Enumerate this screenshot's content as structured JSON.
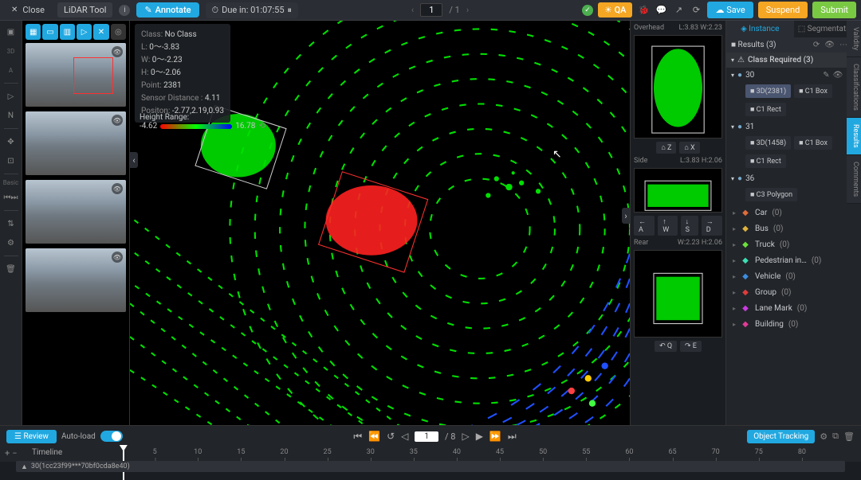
{
  "topbar": {
    "close": "Close",
    "tool": "LiDAR Tool",
    "annotate": "Annotate",
    "timer": "Due in: 01:07:55",
    "qa": "QA",
    "save": "Save",
    "suspend": "Suspend",
    "submit": "Submit"
  },
  "pager": {
    "current": "1",
    "total": "/ 1"
  },
  "tool_rail": {
    "t3d": "3D",
    "ta": "A",
    "basic": "Basic"
  },
  "info": {
    "class_label": "Class:",
    "class": "No Class",
    "L_label": "L:",
    "L": "0～-3.83",
    "W_label": "W:",
    "W": "0～-2.23",
    "H_label": "H:",
    "H": "0～-2.06",
    "point_label": "Point:",
    "point": "2381",
    "sd_label": "Sensor Distance :",
    "sd": "4.11",
    "pos_label": "Positon:",
    "pos": "-2.77,2.19,0.93",
    "hr_label": "Height Range:",
    "hr_min": "-4.62",
    "hr_max": "16.78"
  },
  "sideviews": {
    "overhead": "Overhead",
    "ov_dim": "L:3.83 W:2.23",
    "side": "Side",
    "side_dim": "L:3.83 H:2.06",
    "rear": "Rear",
    "rear_dim": "W:2.23 H:2.06",
    "ctrl1a": "⌂ Z",
    "ctrl1b": "⌂ X",
    "navA": "← A",
    "navW": "↑ W",
    "navS": "↓ S",
    "navD": "→ D",
    "navQ": "↶ Q",
    "navE": "↷ E"
  },
  "right": {
    "tab_instance": "Instance",
    "tab_seg": "Segmentation",
    "results": "Results (3)",
    "class_required": "Class Required  (3)",
    "obj30": "30",
    "obj30_3d": "■ 3D(2381)",
    "obj30_c1b": "■ C1 Box",
    "obj30_c1r": "■ C1 Rect",
    "obj31": "31",
    "obj31_3d": "■ 3D(1458)",
    "obj31_c1b": "■ C1 Box",
    "obj31_c1r": "■ C1 Rect",
    "obj36": "36",
    "obj36_c3": "■ C3 Polygon",
    "classes": [
      {
        "name": "Car",
        "count": "(0)",
        "color": "#e06c3c"
      },
      {
        "name": "Bus",
        "count": "(0)",
        "color": "#e0b43c"
      },
      {
        "name": "Truck",
        "count": "(0)",
        "color": "#6ce03c"
      },
      {
        "name": "Pedestrian in…",
        "count": "(0)",
        "color": "#3ce0b4"
      },
      {
        "name": "Vehicle",
        "count": "(0)",
        "color": "#3c8ce0"
      },
      {
        "name": "Group",
        "count": "(0)",
        "color": "#e03c3c"
      },
      {
        "name": "Lane Mark",
        "count": "(0)",
        "color": "#c83ce0"
      },
      {
        "name": "Building",
        "count": "(0)",
        "color": "#e03c96"
      }
    ]
  },
  "rail": {
    "validity": "Validity",
    "classifications": "Classifications",
    "results": "Results",
    "comments": "Comments"
  },
  "playbar": {
    "review": "Review",
    "autoload": "Auto-load",
    "frame": "1",
    "total": "/ 8",
    "object_tracking": "Object Tracking"
  },
  "timeline": {
    "label": "Timeline",
    "asset": "30(1cc23f99***70bf0cda8e40)",
    "ticks": [
      "5",
      "10",
      "15",
      "20",
      "25",
      "30",
      "35",
      "40",
      "45",
      "50",
      "55",
      "60",
      "65",
      "70",
      "75",
      "80"
    ]
  }
}
